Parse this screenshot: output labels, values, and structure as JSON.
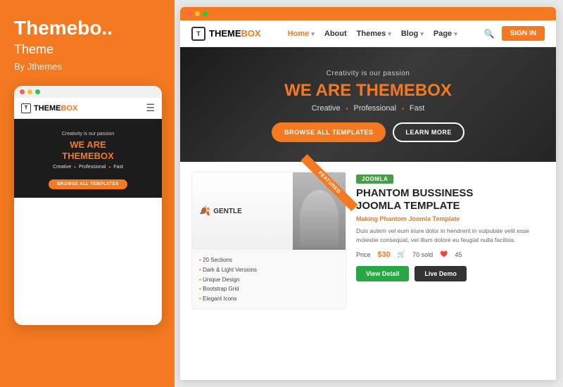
{
  "left": {
    "title": "Themebo..",
    "subtitle": "Theme",
    "author": "By Jthemes",
    "mobile": {
      "dots": [
        "red",
        "yellow",
        "green"
      ],
      "logo_text": "THEME",
      "logo_orange": "BOX",
      "tagline": "Creativity is our passion",
      "headline1": "WE ARE",
      "headline2_orange": "THEMEBOX",
      "features": [
        "Creative",
        "Professional",
        "Fast"
      ],
      "btn_label": "BROWSE ALL TEMPLATES"
    }
  },
  "right": {
    "browser_dots": [
      "red",
      "yellow",
      "green"
    ],
    "nav": {
      "logo_black": "THEME",
      "logo_orange": "BOX",
      "menu": [
        {
          "label": "Home",
          "active": true,
          "has_arrow": true
        },
        {
          "label": "About",
          "active": false
        },
        {
          "label": "Themes",
          "active": false,
          "has_arrow": true
        },
        {
          "label": "Blog",
          "active": false,
          "has_arrow": true
        },
        {
          "label": "Page",
          "active": false,
          "has_arrow": true
        }
      ],
      "signin_label": "SIGN IN"
    },
    "hero": {
      "tagline": "Creativity is our passion",
      "headline_white": "WE ARE ",
      "headline_orange": "THEMEBOX",
      "features": [
        "Creative",
        "Professional",
        "Fast"
      ],
      "btn_primary": "BROWSE ALL TEMPLATES",
      "btn_secondary": "LEARN MORE"
    },
    "product": {
      "card_logo": "GENTLE",
      "card_features": [
        "20 Sections",
        "Dark & Light Versions",
        "Unique Design",
        "Bootstrap Grid",
        "Elegant Icons"
      ],
      "ribbon": "FEATURED",
      "badge": "JOOMLA",
      "title": "PHANTOM BUSSINESS\nJOOMLA TEMPLATE",
      "sub_title": "Making Phantom Joomla Template",
      "description": "Duis autem vel eum iriure dolor in hendrerit in vulputate velit esse molestie consequat, vel illum dolore eu feugiat nulla facilisis.",
      "price_label": "Price",
      "price_old": "$30",
      "price_new": "$30",
      "sold_count": "70 sold",
      "likes_count": "45",
      "btn_view": "View Detail",
      "btn_demo": "Live Demo"
    }
  }
}
